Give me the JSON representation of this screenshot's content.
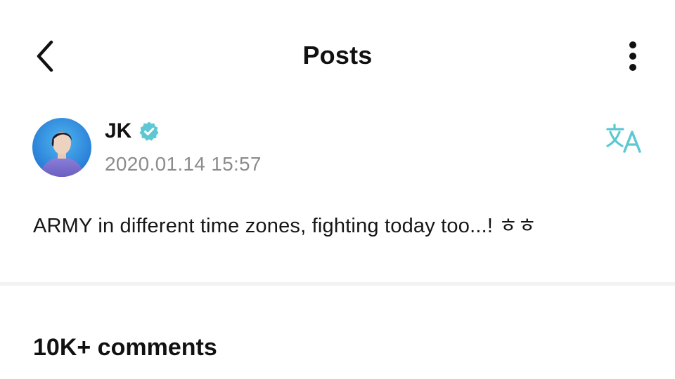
{
  "header": {
    "title": "Posts",
    "back_icon": "chevron-left-icon",
    "more_icon": "more-vertical-icon"
  },
  "post": {
    "author": "JK",
    "verified_icon": "verified-badge-icon",
    "timestamp": "2020.01.14 15:57",
    "translate_icon": "translate-icon",
    "text": "ARMY in different time zones, fighting today too...! ㅎㅎ"
  },
  "comments": {
    "heading": "10K+ comments"
  },
  "colors": {
    "accent": "#5cc8d3",
    "text": "#111111",
    "muted": "#8c8c8c",
    "divider": "#f2f2f2"
  }
}
